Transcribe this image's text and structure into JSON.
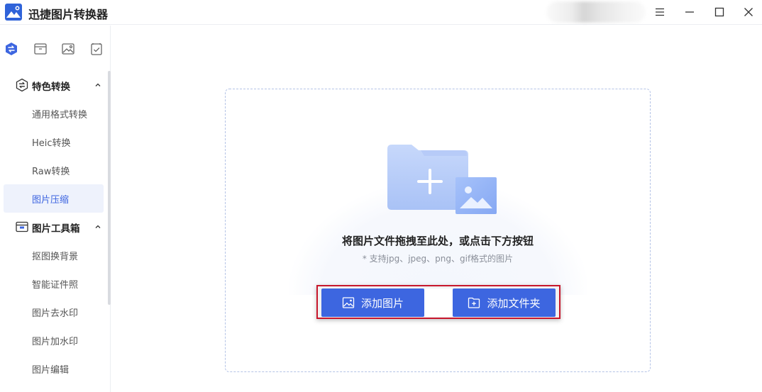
{
  "app": {
    "title": "迅捷图片转换器",
    "logo_icon": "mountain-logo-icon",
    "accent_color": "#3d66e0",
    "highlight_color": "#c8172c"
  },
  "window_controls": {
    "menu_icon": "hamburger-icon",
    "minimize_icon": "minimize-icon",
    "maximize_icon": "maximize-icon",
    "close_icon": "close-icon"
  },
  "tool_tabs": [
    {
      "icon": "convert-icon",
      "active": true
    },
    {
      "icon": "toolbox-icon",
      "active": false
    },
    {
      "icon": "image-icon",
      "active": false
    },
    {
      "icon": "checklist-icon",
      "active": false
    }
  ],
  "sidebar": {
    "groups": [
      {
        "label": "特色转换",
        "icon": "convert-icon",
        "expanded": true,
        "items": [
          {
            "label": "通用格式转换",
            "active": false
          },
          {
            "label": "Heic转换",
            "active": false
          },
          {
            "label": "Raw转换",
            "active": false
          },
          {
            "label": "图片压缩",
            "active": true
          }
        ]
      },
      {
        "label": "图片工具箱",
        "icon": "toolbox-icon",
        "expanded": true,
        "items": [
          {
            "label": "抠图换背景",
            "active": false
          },
          {
            "label": "智能证件照",
            "active": false
          },
          {
            "label": "图片去水印",
            "active": false
          },
          {
            "label": "图片加水印",
            "active": false
          },
          {
            "label": "图片编辑",
            "active": false
          }
        ]
      }
    ]
  },
  "drop_zone": {
    "title": "将图片文件拖拽至此处，或点击下方按钮",
    "hint": "* 支持jpg、jpeg、png、gif格式的图片",
    "illustration_icon": "folder-add-image-icon"
  },
  "actions": {
    "add_image_label": "添加图片",
    "add_image_icon": "image-icon",
    "add_folder_label": "添加文件夹",
    "add_folder_icon": "folder-add-icon"
  }
}
